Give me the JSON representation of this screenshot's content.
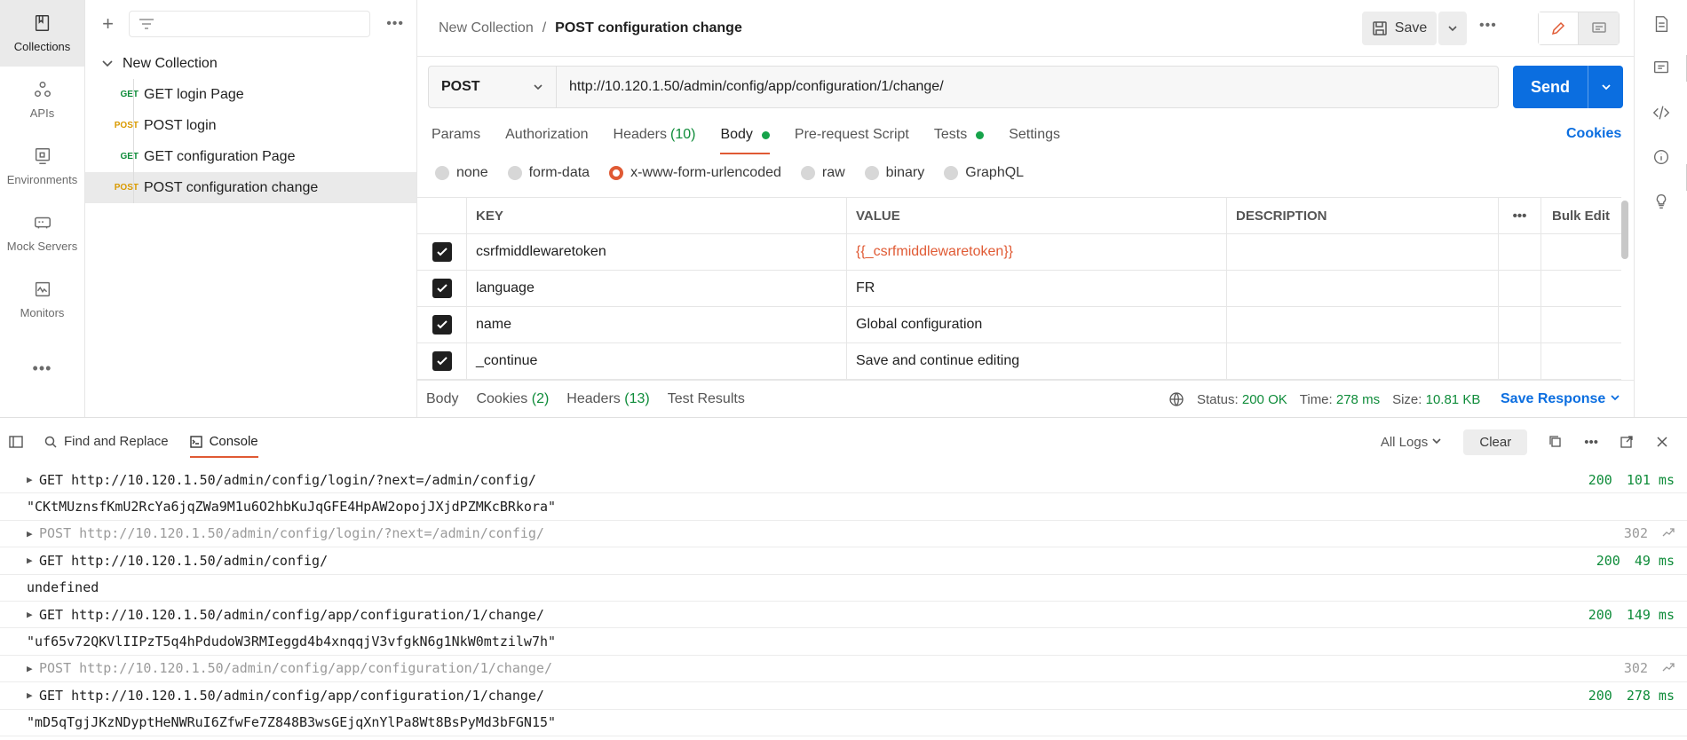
{
  "leftnav": [
    {
      "label": "Collections",
      "icon": "collections-icon",
      "active": true
    },
    {
      "label": "APIs",
      "icon": "apis-icon"
    },
    {
      "label": "Environments",
      "icon": "environments-icon"
    },
    {
      "label": "Mock Servers",
      "icon": "mock-servers-icon"
    },
    {
      "label": "Monitors",
      "icon": "monitors-icon"
    }
  ],
  "sidebar": {
    "collection_name": "New Collection",
    "items": [
      {
        "method": "GET",
        "name": "GET login Page"
      },
      {
        "method": "POST",
        "name": "POST login"
      },
      {
        "method": "GET",
        "name": "GET configuration Page"
      },
      {
        "method": "POST",
        "name": "POST configuration change",
        "active": true
      }
    ]
  },
  "header": {
    "breadcrumb_parent": "New Collection",
    "breadcrumb_sep": "/",
    "title": "POST configuration change",
    "save_label": "Save"
  },
  "request": {
    "method": "POST",
    "url": "http://10.120.1.50/admin/config/app/configuration/1/change/",
    "send_label": "Send"
  },
  "tabs": {
    "params": "Params",
    "authorization": "Authorization",
    "headers": "Headers",
    "headers_count": "(10)",
    "body": "Body",
    "prerequest": "Pre-request Script",
    "tests": "Tests",
    "settings": "Settings",
    "cookies": "Cookies"
  },
  "body_types": [
    {
      "label": "none"
    },
    {
      "label": "form-data"
    },
    {
      "label": "x-www-form-urlencoded",
      "selected": true
    },
    {
      "label": "raw"
    },
    {
      "label": "binary"
    },
    {
      "label": "GraphQL"
    }
  ],
  "params_table": {
    "headers": {
      "key": "KEY",
      "value": "VALUE",
      "description": "DESCRIPTION",
      "bulk": "Bulk Edit"
    },
    "rows": [
      {
        "key": "csrfmiddlewaretoken",
        "value": "{{_csrfmiddlewaretoken}}",
        "is_var": true
      },
      {
        "key": "language",
        "value": "FR"
      },
      {
        "key": "name",
        "value": "Global configuration"
      },
      {
        "key": "_continue",
        "value": "Save and continue editing"
      }
    ]
  },
  "response": {
    "body": "Body",
    "cookies": "Cookies",
    "cookies_count": "(2)",
    "headers": "Headers",
    "headers_count": "(13)",
    "test_results": "Test Results",
    "status_label": "Status:",
    "status": "200 OK",
    "time_label": "Time:",
    "time": "278 ms",
    "size_label": "Size:",
    "size": "10.81 KB",
    "save_response": "Save Response"
  },
  "console_bar": {
    "find_replace": "Find and Replace",
    "console": "Console",
    "all_logs": "All Logs",
    "clear": "Clear"
  },
  "console_rows": [
    {
      "type": "req",
      "text": "GET http://10.120.1.50/admin/config/login/?next=/admin/config/",
      "status": "200",
      "time": "101 ms"
    },
    {
      "type": "log",
      "text": "\"CKtMUznsfKmU2RcYa6jqZWa9M1u6O2hbKuJqGFE4HpAW2opojJXjdPZMKcBRkora\""
    },
    {
      "type": "dim",
      "text": "POST http://10.120.1.50/admin/config/login/?next=/admin/config/",
      "status": "302",
      "time": ""
    },
    {
      "type": "req",
      "text": "GET http://10.120.1.50/admin/config/",
      "status": "200",
      "time": "49 ms"
    },
    {
      "type": "log",
      "text": "undefined"
    },
    {
      "type": "req",
      "text": "GET http://10.120.1.50/admin/config/app/configuration/1/change/",
      "status": "200",
      "time": "149 ms"
    },
    {
      "type": "log",
      "text": "\"uf65v72QKVlIIPzT5q4hPdudoW3RMIeggd4b4xnqqjV3vfgkN6g1NkW0mtzilw7h\""
    },
    {
      "type": "dim",
      "text": "POST http://10.120.1.50/admin/config/app/configuration/1/change/",
      "status": "302",
      "time": ""
    },
    {
      "type": "req",
      "text": "GET http://10.120.1.50/admin/config/app/configuration/1/change/",
      "status": "200",
      "time": "278 ms"
    },
    {
      "type": "log",
      "text": "\"mD5qTgjJKzNDyptHeNWRuI6ZfwFe7Z848B3wsGEjqXnYlPa8Wt8BsPyMd3bFGN15\""
    }
  ]
}
